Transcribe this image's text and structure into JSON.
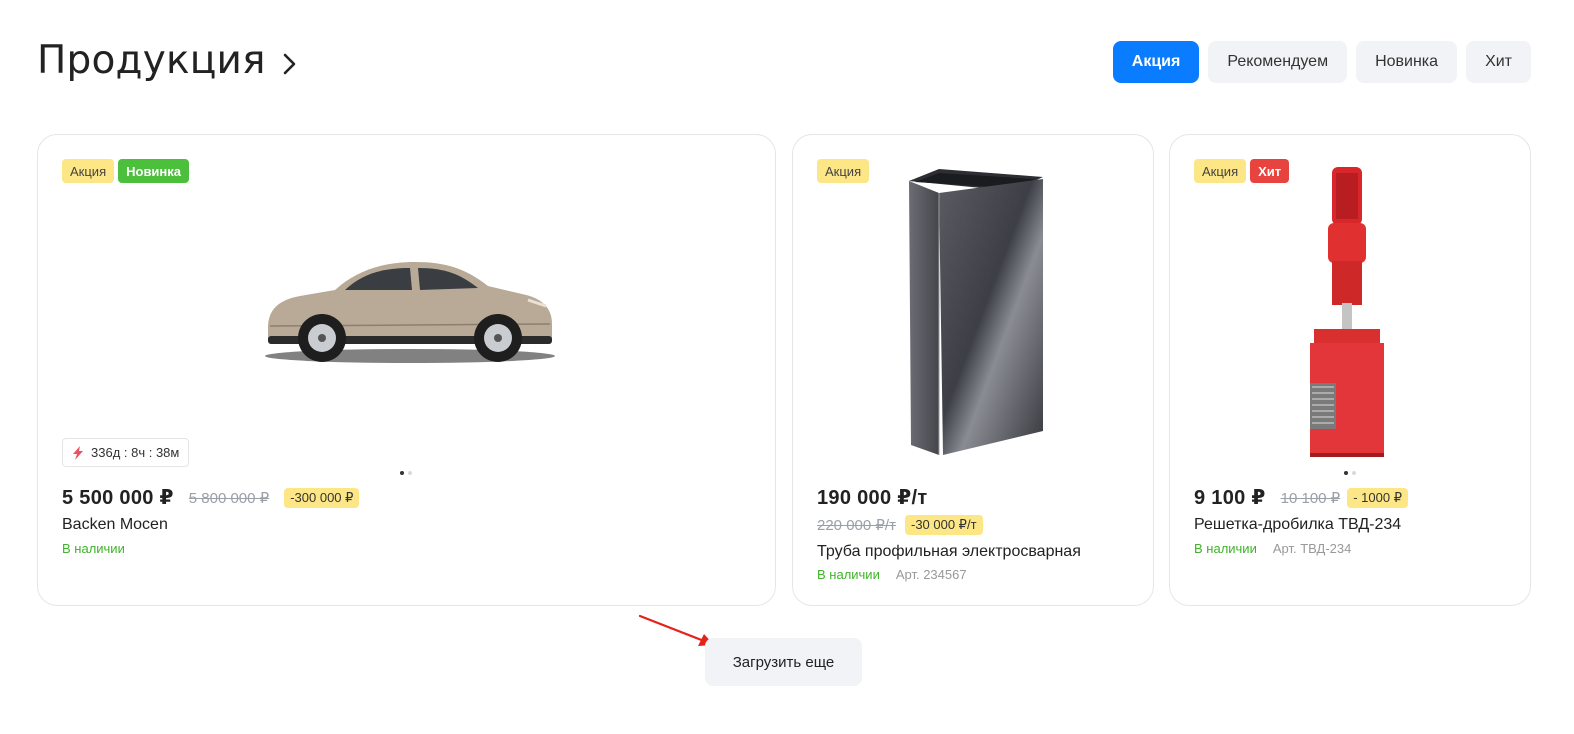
{
  "header": {
    "title": "Продукция",
    "chevron_icon": "chevron-right-icon"
  },
  "filters": [
    {
      "label": "Акция",
      "active": true
    },
    {
      "label": "Рекомендуем",
      "active": false
    },
    {
      "label": "Новинка",
      "active": false
    },
    {
      "label": "Хит",
      "active": false
    }
  ],
  "products": [
    {
      "badges": [
        "Акция",
        "Новинка"
      ],
      "image": "car-image",
      "timer": "336д : 8ч : 38м",
      "price": "5 500 000 ₽",
      "old_price": "5 800 000 ₽",
      "discount": "-300 000 ₽",
      "name": "Backen Mocen",
      "stock": "В наличии",
      "article": ""
    },
    {
      "badges": [
        "Акция"
      ],
      "image": "profile-pipe-image",
      "price": "190 000 ₽/т",
      "old_price": "220 000 ₽/т",
      "discount": "-30 000 ₽/т",
      "name": "Труба профильная электросварная",
      "stock": "В наличии",
      "article": "Арт. 234567"
    },
    {
      "badges": [
        "Акция",
        "Хит"
      ],
      "image": "crusher-grate-image",
      "price": "9 100 ₽",
      "old_price": "10 100 ₽",
      "discount": "- 1000 ₽",
      "name": "Решетка-дробилка ТВД-234",
      "stock": "В наличии",
      "article": "Арт. ТВД-234"
    }
  ],
  "load_more": "Загрузить еще",
  "colors": {
    "accent": "#0a7cff",
    "sale_badge": "#fde686",
    "new_badge": "#4cbf3c",
    "hit_badge": "#e8443f",
    "in_stock": "#3fb32a"
  }
}
